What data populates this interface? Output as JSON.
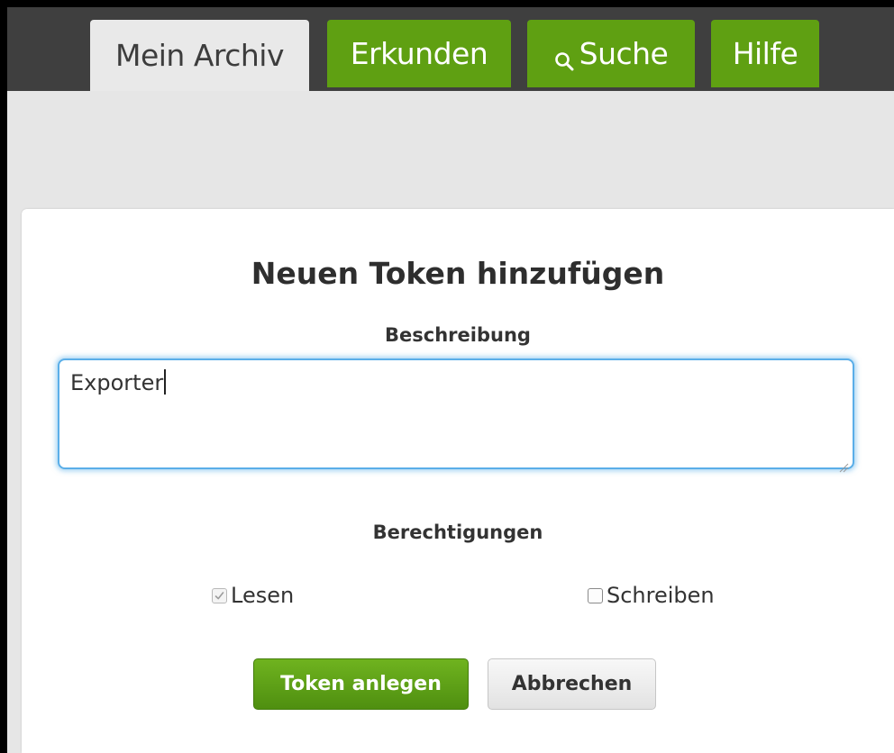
{
  "nav": {
    "tabs": [
      {
        "label": "Mein Archiv",
        "active": true
      },
      {
        "label": "Erkunden",
        "active": false
      },
      {
        "label": "Suche",
        "active": false,
        "icon": "search-icon"
      },
      {
        "label": "Hilfe",
        "active": false
      }
    ]
  },
  "form": {
    "title": "Neuen Token hinzufügen",
    "description_label": "Beschreibung",
    "description_value": "Exporter",
    "permissions_label": "Berechtigungen",
    "permissions": [
      {
        "label": "Lesen",
        "checked": true,
        "disabled": true
      },
      {
        "label": "Schreiben",
        "checked": false,
        "disabled": false
      }
    ],
    "submit_label": "Token anlegen",
    "cancel_label": "Abbrechen"
  },
  "colors": {
    "nav_background": "#3f3f3f",
    "tab_green": "#5fa012",
    "focus_blue": "#5aaee8"
  }
}
